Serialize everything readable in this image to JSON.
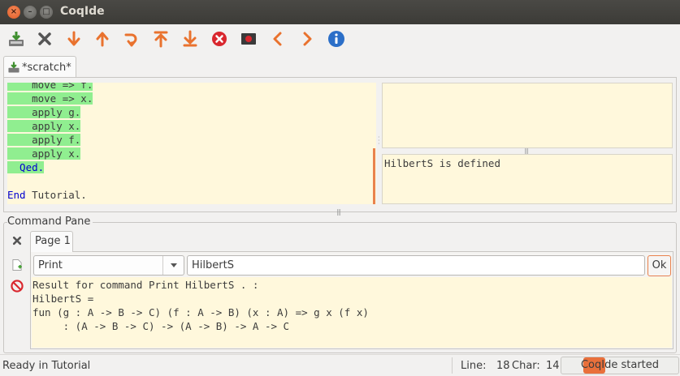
{
  "window": {
    "title": "CoqIde"
  },
  "toolbar": {
    "buttons": [
      {
        "name": "save-button",
        "icon": "save-icon"
      },
      {
        "name": "close-button",
        "icon": "x-icon"
      },
      {
        "name": "forward-button",
        "icon": "arrow-down-icon"
      },
      {
        "name": "backward-button",
        "icon": "arrow-up-icon"
      },
      {
        "name": "go-to-cursor-button",
        "icon": "arrow-redo-icon"
      },
      {
        "name": "go-to-start-button",
        "icon": "arrow-top-icon"
      },
      {
        "name": "go-to-end-button",
        "icon": "arrow-bottom-icon"
      },
      {
        "name": "interrupt-button",
        "icon": "stop-icon"
      },
      {
        "name": "restart-button",
        "icon": "media-stop-icon"
      },
      {
        "name": "previous-button",
        "icon": "chevron-left-icon"
      },
      {
        "name": "next-button",
        "icon": "chevron-right-icon"
      },
      {
        "name": "about-button",
        "icon": "info-icon"
      }
    ]
  },
  "document_tab": {
    "label": "*scratch*"
  },
  "script": {
    "lines": [
      {
        "text": "    move => f.",
        "processed": true
      },
      {
        "text": "    move => x.",
        "processed": true
      },
      {
        "text": "    apply g.",
        "processed": true
      },
      {
        "text": "    apply x.",
        "processed": true
      },
      {
        "text": "    apply f.",
        "processed": true
      },
      {
        "text": "    apply x.",
        "processed": true
      },
      {
        "text": "  Qed.",
        "processed": true,
        "keyword": true
      },
      {
        "text": "",
        "processed": false
      },
      {
        "kw": "End",
        "text": " Tutorial.",
        "processed": false
      }
    ]
  },
  "messages": {
    "text": "HilbertS is defined"
  },
  "command_pane": {
    "title": "Command Pane",
    "page_tab": "Page 1",
    "command": "Print",
    "argument": "HilbertS",
    "ok_label": "Ok",
    "result_lines": [
      "Result for command Print HilbertS . :",
      "HilbertS =",
      "fun (g : A -> B -> C) (f : A -> B) (x : A) => g x (f x)",
      "     : (A -> B -> C) -> (A -> B) -> A -> C"
    ]
  },
  "statusbar": {
    "ready": "Ready in Tutorial",
    "line_label": "Line:",
    "line_value": "18",
    "char_label": "Char:",
    "char_value": "14",
    "progress_text": "CoqIde started"
  },
  "colors": {
    "processed": "#90ee90",
    "script_bg": "#fff8dc",
    "accent": "#e9824d",
    "keyword": "#0000d0"
  }
}
